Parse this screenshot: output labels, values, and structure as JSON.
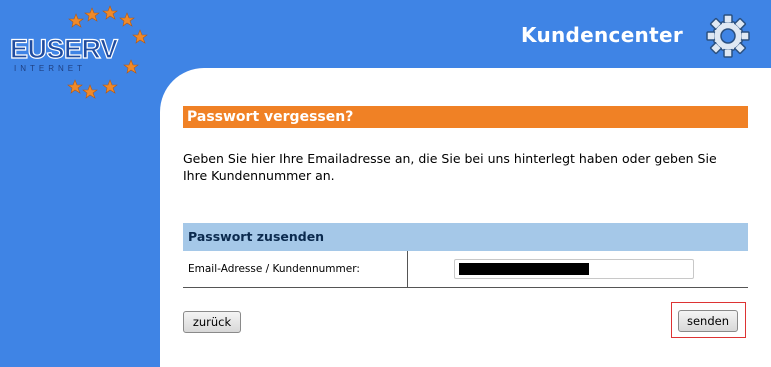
{
  "brand": {
    "logo_text": "EUSERV",
    "logo_sub": "INTERNET"
  },
  "header": {
    "title": "Kundencenter"
  },
  "main": {
    "section_title": "Passwort vergessen?",
    "intro_text": "Geben Sie hier Ihre Emailadresse an, die Sie bei uns hinterlegt haben oder geben Sie Ihre Kundennummer an.",
    "form": {
      "title": "Passwort zusenden",
      "field_label": "Email-Adresse / Kundennummer:",
      "field_value": ""
    },
    "buttons": {
      "back": "zurück",
      "send": "senden"
    }
  },
  "colors": {
    "background": "#3f84e5",
    "accent_orange": "#f08125",
    "form_header": "#a5c8e8",
    "highlight_border": "#dd3333"
  }
}
